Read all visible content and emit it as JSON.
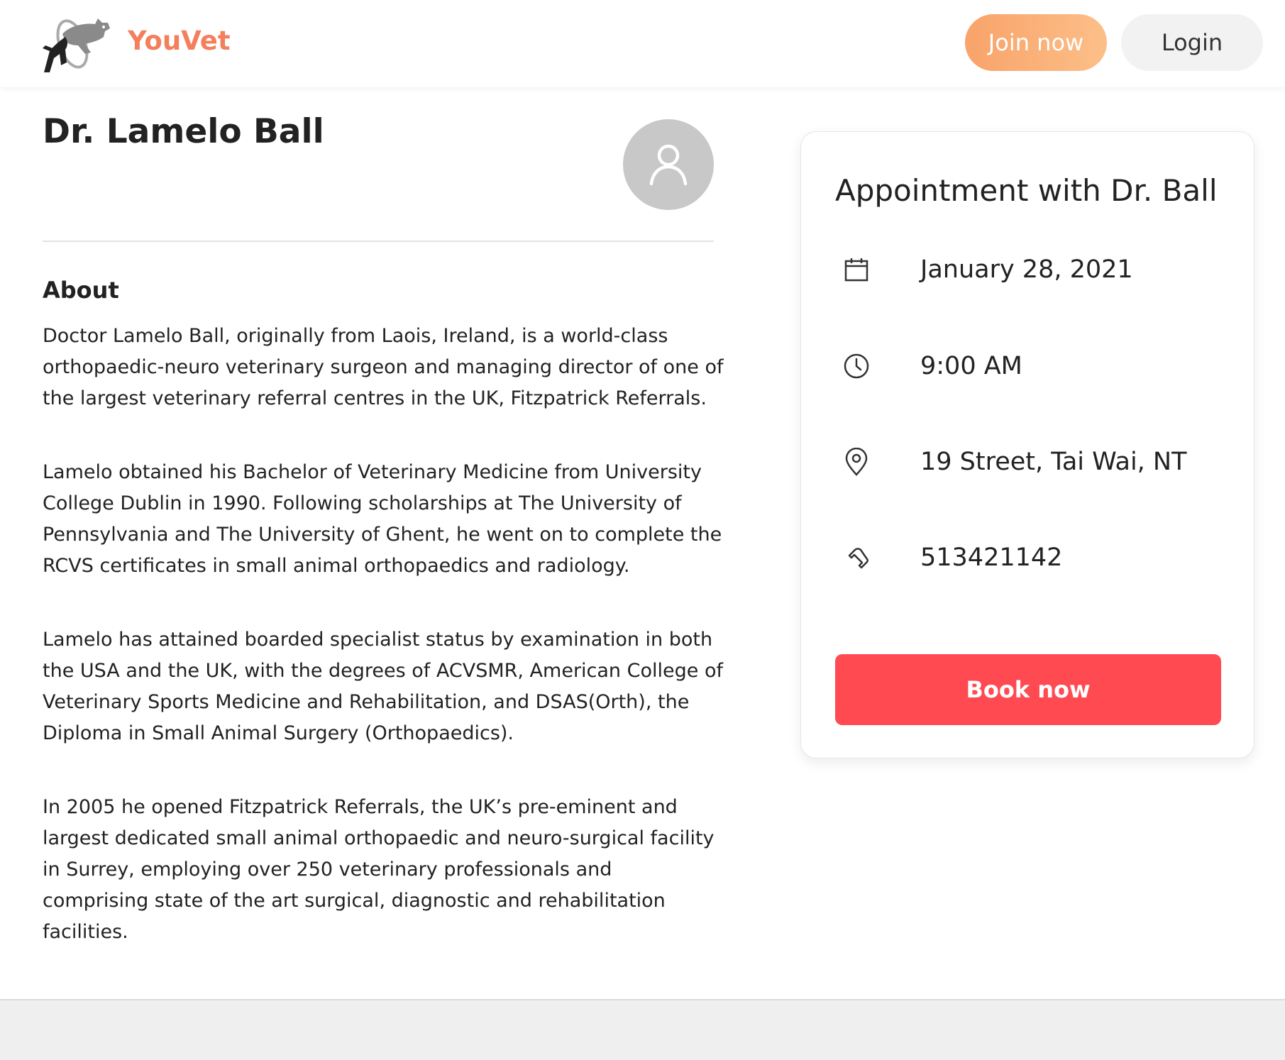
{
  "header": {
    "brand": "YouVet",
    "logo_icon": "dog-jumping-hoop-icon",
    "join_label": "Join now",
    "login_label": "Login"
  },
  "doctor": {
    "name": "Dr. Lamelo Ball",
    "avatar_icon": "user-icon"
  },
  "about": {
    "title": "About",
    "paragraphs": [
      "Doctor Lamelo Ball, originally from Laois, Ireland, is a world-class orthopaedic-neuro veterinary surgeon and managing director of one of the largest veterinary referral centres in the UK, Fitzpatrick Referrals.",
      "Lamelo obtained his Bachelor of Veterinary Medicine from University College Dublin in 1990. Following scholarships at The University of Pennsylvania and The University of Ghent, he went on to complete the RCVS certificates in small animal orthopaedics and radiology.",
      "Lamelo has attained boarded specialist status by examination in both the USA and the UK, with the degrees of ACVSMR, American College of Veterinary Sports Medicine and Rehabilitation, and DSAS(Orth), the Diploma in Small Animal Surgery (Orthopaedics).",
      "In 2005 he opened Fitzpatrick Referrals, the UK’s pre-eminent and largest dedicated small animal orthopaedic and neuro-surgical facility in Surrey, employing over 250 veterinary professionals and comprising state of the art surgical, diagnostic and rehabilitation facilities."
    ]
  },
  "appointment": {
    "title": "Appointment with Dr. Ball",
    "date": "January 28, 2021",
    "time": "9:00 AM",
    "location": "19 Street, Tai Wai, NT",
    "phone": "513421142",
    "icons": {
      "date": "calendar-icon",
      "time": "clock-icon",
      "location": "map-pin-icon",
      "phone": "phone-icon"
    },
    "book_label": "Book now"
  },
  "colors": {
    "brand": "#f47f5c",
    "join_gradient_start": "#f8a36a",
    "join_gradient_end": "#fcbf88",
    "book_button": "#ff4a52",
    "avatar_bg": "#c8c8c8"
  }
}
